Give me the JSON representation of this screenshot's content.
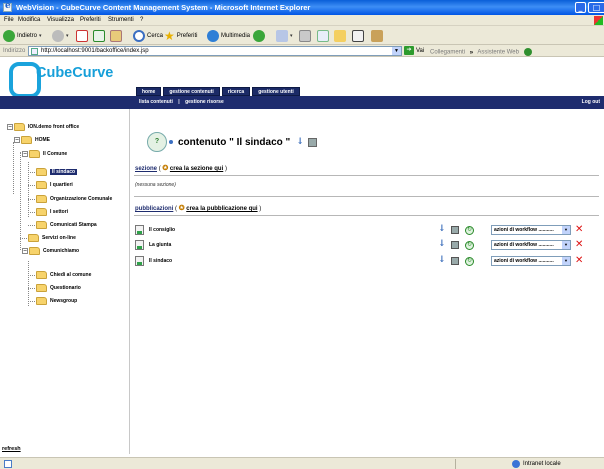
{
  "window": {
    "title": "WebVision - CubeCurve Content Management System - Microsoft Internet Explorer"
  },
  "menu": [
    "File",
    "Modifica",
    "Visualizza",
    "Preferiti",
    "Strumenti",
    "?"
  ],
  "toolbar": {
    "back": "Indietro",
    "search": "Cerca",
    "favorites": "Preferiti",
    "media": "Multimedia"
  },
  "address": {
    "label": "Indirizzo",
    "url": "http://localhost:9001/backoffice/index.jsp",
    "go": "Vai",
    "links": "Collegamenti",
    "chevrons": "»",
    "assistant": "Assistente Web"
  },
  "brand": {
    "name": "CubeCurve"
  },
  "tabs": [
    "home",
    "gestione contenuti",
    "ricerca",
    "gestione utenti"
  ],
  "subnav": {
    "item1": "lista contenuti",
    "separator": "|",
    "item2": "gestione risorse",
    "logout": "Log out"
  },
  "tree": [
    {
      "label": "ION.demo front office"
    },
    {
      "label": "HOME"
    },
    {
      "label": "Il Comune"
    },
    {
      "label": "Il sindaco",
      "selected": true
    },
    {
      "label": "I quartieri"
    },
    {
      "label": "Organizzazione Comunale"
    },
    {
      "label": "I settori"
    },
    {
      "label": "Comunicati Stampa"
    },
    {
      "label": "Servizi on-line"
    },
    {
      "label": "Comunichiamo"
    },
    {
      "label": "Chiedi al comune"
    },
    {
      "label": "Questionario"
    },
    {
      "label": "Newsgroup"
    }
  ],
  "refresh": "refresh",
  "main": {
    "title": "contenuto \" Il sindaco \"",
    "section_label": "sezione",
    "section_open": "(",
    "section_link": "crea la sezione qui",
    "section_close": ")",
    "no_section": "(nessuna sezione)",
    "publications_label": "pubblicazioni",
    "publications_open": "(",
    "publications_link": "crea la pubblicazione qui",
    "publications_close": ")",
    "publications": [
      {
        "name": "Il consiglio",
        "workflow": "azioni di workflow ..........."
      },
      {
        "name": "La giunta",
        "workflow": "azioni di workflow ..........."
      },
      {
        "name": "Il sindaco",
        "workflow": "azioni di workflow ..........."
      }
    ]
  },
  "status": {
    "zone": "Intranet locale"
  },
  "icons": {
    "back": "back-arrow-icon",
    "forward": "forward-arrow-icon",
    "stop": "stop-icon",
    "refresh": "refresh-icon",
    "home": "home-icon",
    "search": "search-icon",
    "favorites": "star-icon",
    "media": "media-icon",
    "history": "history-icon",
    "mail": "mail-icon",
    "print": "print-icon",
    "edit": "edit-icon"
  }
}
